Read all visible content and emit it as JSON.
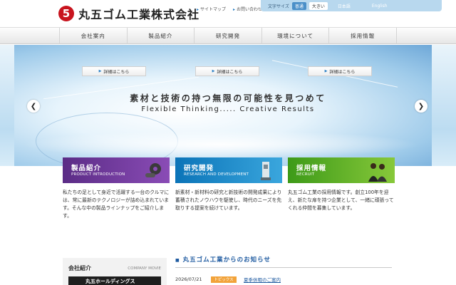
{
  "header": {
    "logo_mark": "5",
    "company_name": "丸五ゴム工業株式会社",
    "util_links": [
      "サイトマップ",
      "お問い合わせ"
    ],
    "font_size_label": "文字サイズ",
    "font_size_normal": "普通",
    "font_size_large": "大きい",
    "lang_jp": "日本語",
    "lang_en": "English"
  },
  "nav": {
    "items": [
      "会社案内",
      "製品紹介",
      "研究開発",
      "環境について",
      "採用情報"
    ]
  },
  "hero": {
    "title": "素材と技術の持つ無限の可能性を見つめて",
    "subtitle": "Flexible Thinking..... Creative Results",
    "prev_icon": "chevron-left-icon",
    "next_icon": "chevron-right-icon"
  },
  "cards": [
    {
      "title": "製品紹介",
      "subtitle": "PRODUCT INTRODUCTION",
      "text": "私たちの足として身近で活躍する一台のクルマには、常に最新のテクノロジーが詰め込まれています。そんな中の製品ラインナップをご紹介します。",
      "button": "詳細はこちら",
      "color": "#6a3597"
    },
    {
      "title": "研究開発",
      "subtitle": "RESEARCH AND DEVELOPMENT",
      "text": "新素材・新材料の研究と新技術の開発成果により蓄積されたノウハウを駆使し、時代のニーズを先取りする提案を続けています。",
      "button": "詳細はこちら",
      "color": "#1a86c8"
    },
    {
      "title": "採用情報",
      "subtitle": "RECRUIT",
      "text": "丸五ゴム工業の採用情報です。創立100年を迎え、新たな扉を持つ企業として、一緒に頑張ってくれる仲間を募集しています。",
      "button": "詳細はこちら",
      "color": "#5aad22"
    }
  ],
  "company": {
    "heading": "会社紹介",
    "movie_label": "COMPANY MOVIE",
    "video_title": "丸五ホールディングス"
  },
  "news": {
    "heading": "丸五ゴム工業からのお知らせ",
    "items": [
      {
        "date": "2026/07/21",
        "badge": "トピックス",
        "title": "夏季休暇のご案内"
      }
    ]
  },
  "colors": {
    "brand_red": "#c8141e",
    "link_blue": "#1e5aa0",
    "badge_orange": "#f2a33a"
  }
}
